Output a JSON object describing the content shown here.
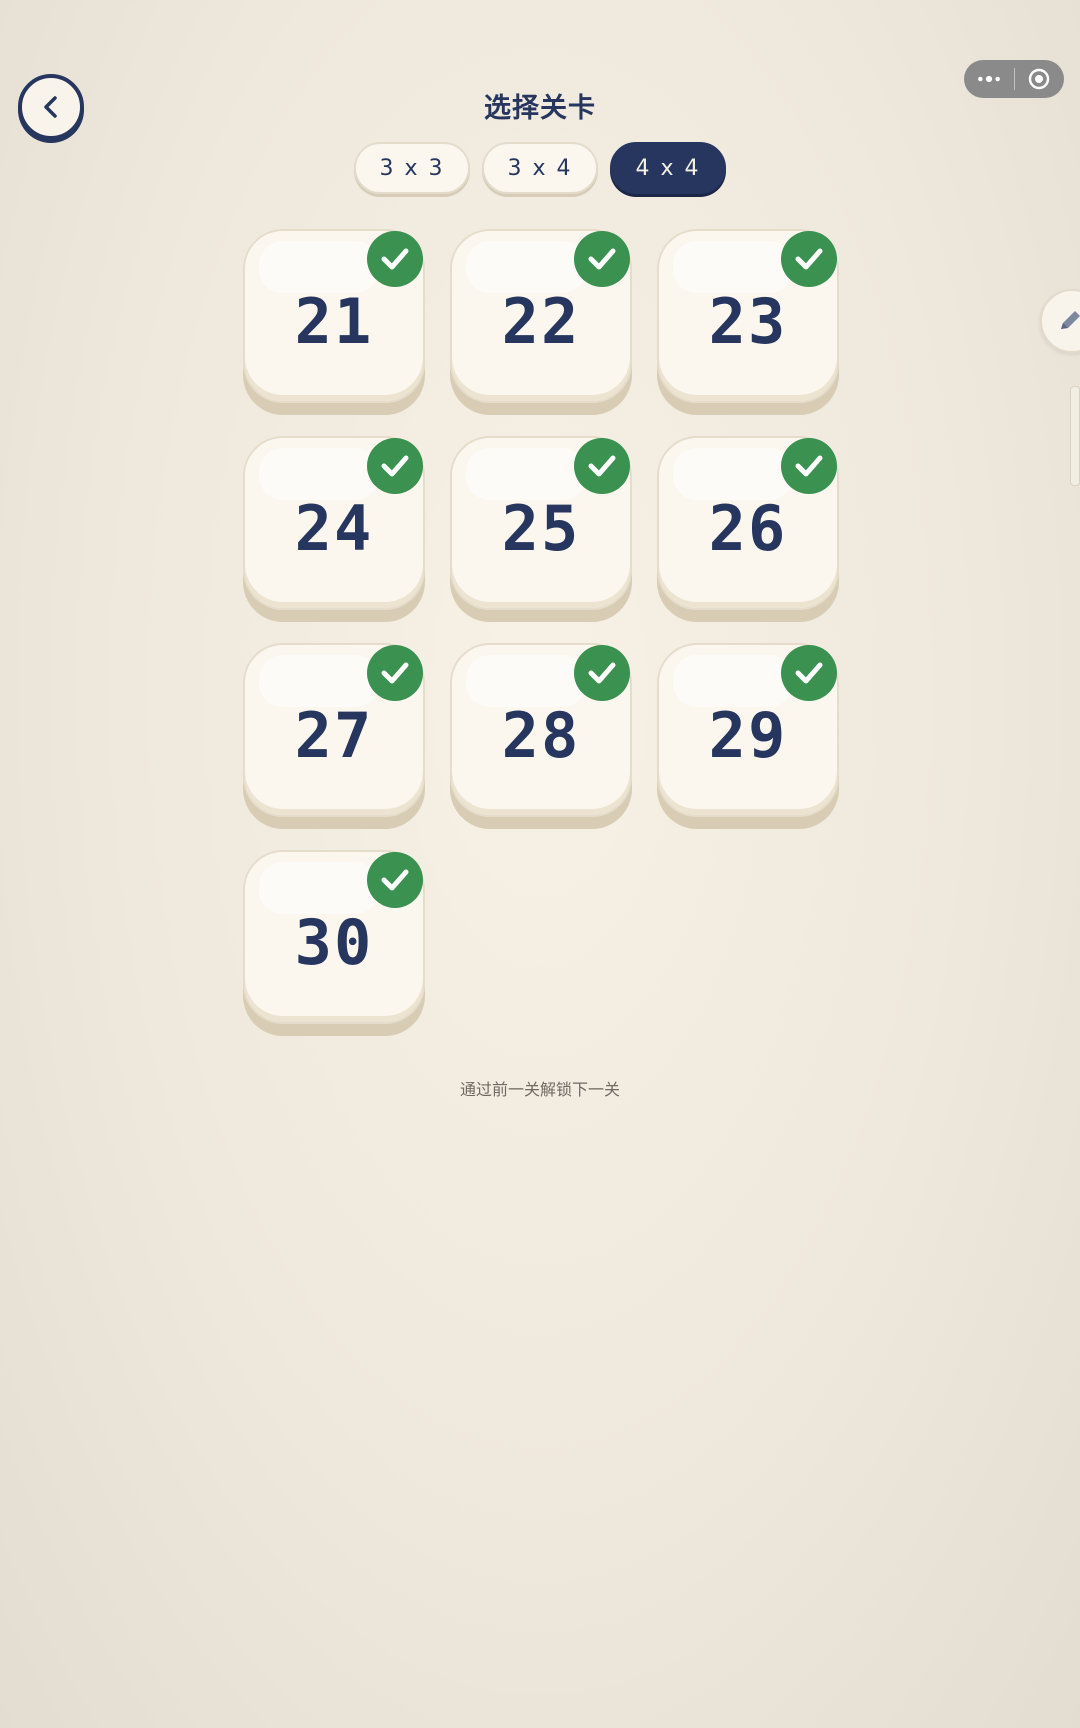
{
  "header": {
    "title": "选择关卡",
    "back_icon": "chevron-left-icon"
  },
  "capsule": {
    "more_icon": "more-dots-icon",
    "close_icon": "target-circle-icon"
  },
  "tabs": [
    {
      "label": "3 x 3",
      "active": false
    },
    {
      "label": "3 x 4",
      "active": false
    },
    {
      "label": "4 x 4",
      "active": true
    }
  ],
  "levels": [
    {
      "number": "21",
      "completed": true
    },
    {
      "number": "22",
      "completed": true
    },
    {
      "number": "23",
      "completed": true
    },
    {
      "number": "24",
      "completed": true
    },
    {
      "number": "25",
      "completed": true
    },
    {
      "number": "26",
      "completed": true
    },
    {
      "number": "27",
      "completed": true
    },
    {
      "number": "28",
      "completed": true
    },
    {
      "number": "29",
      "completed": true
    },
    {
      "number": "30",
      "completed": true
    }
  ],
  "hint": "通过前一关解锁下一关",
  "side_button_icon": "pencil-icon",
  "colors": {
    "primary": "#26365e",
    "check": "#3a9150",
    "tile": "#fbf7ef",
    "tile_shadow": "#d8cdb4"
  }
}
